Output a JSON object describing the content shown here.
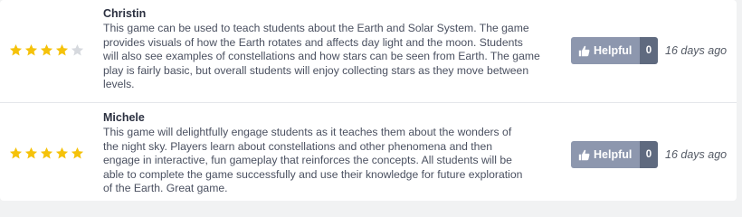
{
  "colors": {
    "star_filled": "#f5c20a",
    "star_empty": "#d6d9de",
    "helpful_bg": "#8d97ae",
    "count_bg": "#5f6a7f"
  },
  "reviews": [
    {
      "author": "Christin",
      "rating": 4,
      "max_rating": 5,
      "body_lines": [
        "This game can be used to teach students about the Earth and Solar System. The game",
        "provides visuals of how the Earth rotates and affects day light and the moon. Students",
        "will also see examples of constellations and how stars can be seen from Earth. The game",
        "play is fairly basic, but overall students will enjoy collecting stars as they move between",
        "levels."
      ],
      "helpful_label": "Helpful",
      "helpful_count": "0",
      "date": "16 days ago"
    },
    {
      "author": "Michele",
      "rating": 5,
      "max_rating": 5,
      "body_lines": [
        "This game will delightfully engage students as it teaches them about the wonders of",
        "the night sky. Players learn about constellations and other phenomena and then",
        "engage in interactive, fun gameplay that reinforces the concepts. All students will be",
        "able to complete the game successfully and use their knowledge for future exploration",
        "of the Earth. Great game."
      ],
      "helpful_label": "Helpful",
      "helpful_count": "0",
      "date": "16 days ago"
    }
  ],
  "icons": {
    "star": "star-icon",
    "thumb": "thumbs-up-icon"
  }
}
